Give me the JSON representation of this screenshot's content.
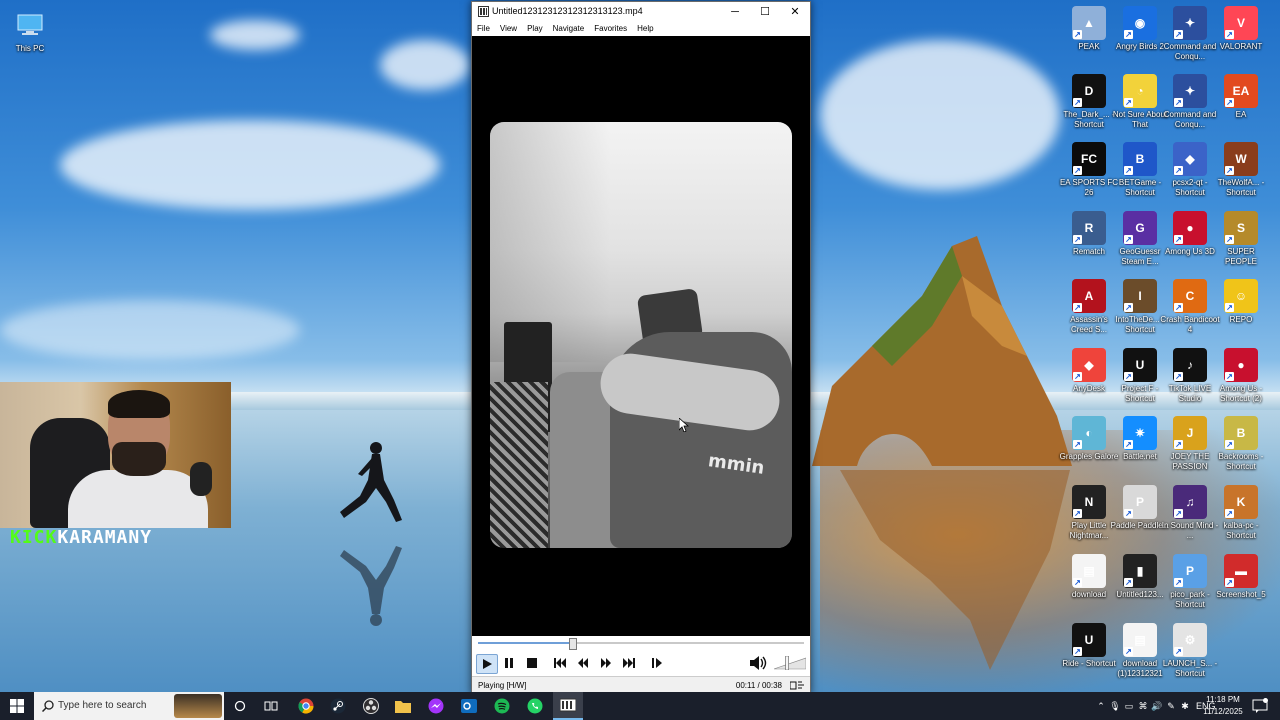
{
  "desktop": {
    "this_pc_label": "This PC",
    "icons": [
      {
        "label": "PEAK",
        "color": "#8fb0d9",
        "glyph": "▲"
      },
      {
        "label": "Angry Birds 2",
        "color": "#1a6fe0",
        "glyph": "◉"
      },
      {
        "label": "Command and Conqu...",
        "color": "#2c4f9e",
        "glyph": "✦"
      },
      {
        "label": "VALORANT",
        "color": "#ff4655",
        "glyph": "V"
      },
      {
        "label": "The_Dark_... - Shortcut",
        "color": "#111111",
        "glyph": "D"
      },
      {
        "label": "Not Sure About That",
        "color": "#f2d23a",
        "glyph": "◔"
      },
      {
        "label": "Command and Conqu...",
        "color": "#2c4f9e",
        "glyph": "✦"
      },
      {
        "label": "EA",
        "color": "#e24a1f",
        "glyph": "EA"
      },
      {
        "label": "EA SPORTS FC 26",
        "color": "#0b0b0b",
        "glyph": "FC"
      },
      {
        "label": "BETGame - Shortcut",
        "color": "#1f57c9",
        "glyph": "B"
      },
      {
        "label": "pcsx2-qt - Shortcut",
        "color": "#3b63c8",
        "glyph": "◆"
      },
      {
        "label": "TheWolfA... - Shortcut",
        "color": "#8a3d1c",
        "glyph": "W"
      },
      {
        "label": "Rematch",
        "color": "#3a5d8f",
        "glyph": "R"
      },
      {
        "label": "GeoGuessr Steam E...",
        "color": "#5a2fa3",
        "glyph": "G"
      },
      {
        "label": "Among Us 3D",
        "color": "#c8102e",
        "glyph": "●"
      },
      {
        "label": "SUPER PEOPLE",
        "color": "#b58a2a",
        "glyph": "S"
      },
      {
        "label": "Assassin's Creed S...",
        "color": "#b3121d",
        "glyph": "A"
      },
      {
        "label": "IntoTheDe... - Shortcut",
        "color": "#6b4c2a",
        "glyph": "I"
      },
      {
        "label": "Crash Bandicoot 4",
        "color": "#e06a12",
        "glyph": "C"
      },
      {
        "label": "REPO",
        "color": "#f0c419",
        "glyph": "☺"
      },
      {
        "label": "AnyDesk",
        "color": "#ef443b",
        "glyph": "◆"
      },
      {
        "label": "Project F - Shortcut",
        "color": "#111111",
        "glyph": "U"
      },
      {
        "label": "TikTok LIVE Studio",
        "color": "#111111",
        "glyph": "♪"
      },
      {
        "label": "Among Us - Shortcut (2)",
        "color": "#c8102e",
        "glyph": "●"
      },
      {
        "label": "Grapples Galore",
        "color": "#5fb6d6",
        "glyph": "◐"
      },
      {
        "label": "Battle.net",
        "color": "#148eff",
        "glyph": "✷"
      },
      {
        "label": "JOEY THE PASSION",
        "color": "#d9a21c",
        "glyph": "J"
      },
      {
        "label": "Backrooms - Shortcut",
        "color": "#c8b846",
        "glyph": "B"
      },
      {
        "label": "Play Little Nightmar...",
        "color": "#222222",
        "glyph": "N"
      },
      {
        "label": "Paddle Paddle...",
        "color": "#d9d9d9",
        "glyph": "P"
      },
      {
        "label": "In Sound Mind - ...",
        "color": "#4a2a7a",
        "glyph": "♫"
      },
      {
        "label": "kalba-pc - Shortcut",
        "color": "#c8742a",
        "glyph": "K"
      },
      {
        "label": "download",
        "color": "#f4f4f4",
        "glyph": "▤"
      },
      {
        "label": "Untitled123...",
        "color": "#222222",
        "glyph": "▮"
      },
      {
        "label": "pico_park - Shortcut",
        "color": "#5aa0e6",
        "glyph": "P"
      },
      {
        "label": "Screenshot_5",
        "color": "#d12b2b",
        "glyph": "▬"
      },
      {
        "label": "Ride - Shortcut",
        "color": "#111111",
        "glyph": "U"
      },
      {
        "label": "download (1)12312321",
        "color": "#f4f4f4",
        "glyph": "▤"
      },
      {
        "label": "LAUNCH_S... - Shortcut",
        "color": "#e4e4e4",
        "glyph": "⚙"
      }
    ]
  },
  "stream_overlay": {
    "handle_prefix": "KICK",
    "handle_name": "KARAMANY"
  },
  "player": {
    "title": "Untitled12312312312312313123.mp4",
    "menu": [
      "File",
      "View",
      "Play",
      "Navigate",
      "Favorites",
      "Help"
    ],
    "video_shirt_text": "mmin",
    "progress_fraction": 0.289,
    "status": "Playing [H/W]",
    "time": "00:11 / 00:38",
    "volume_fraction": 0.4
  },
  "taskbar": {
    "search_placeholder": "Type here to search",
    "apps": [
      "cortana-icon",
      "task-view-icon",
      "chrome-icon",
      "steam-icon",
      "obs-icon",
      "file-explorer-icon",
      "messenger-icon",
      "outlook-icon",
      "spotify-icon",
      "whatsapp-icon",
      "media-player-icon"
    ],
    "language": "ENG",
    "time": "11:18 PM",
    "date": "11/12/2025"
  }
}
